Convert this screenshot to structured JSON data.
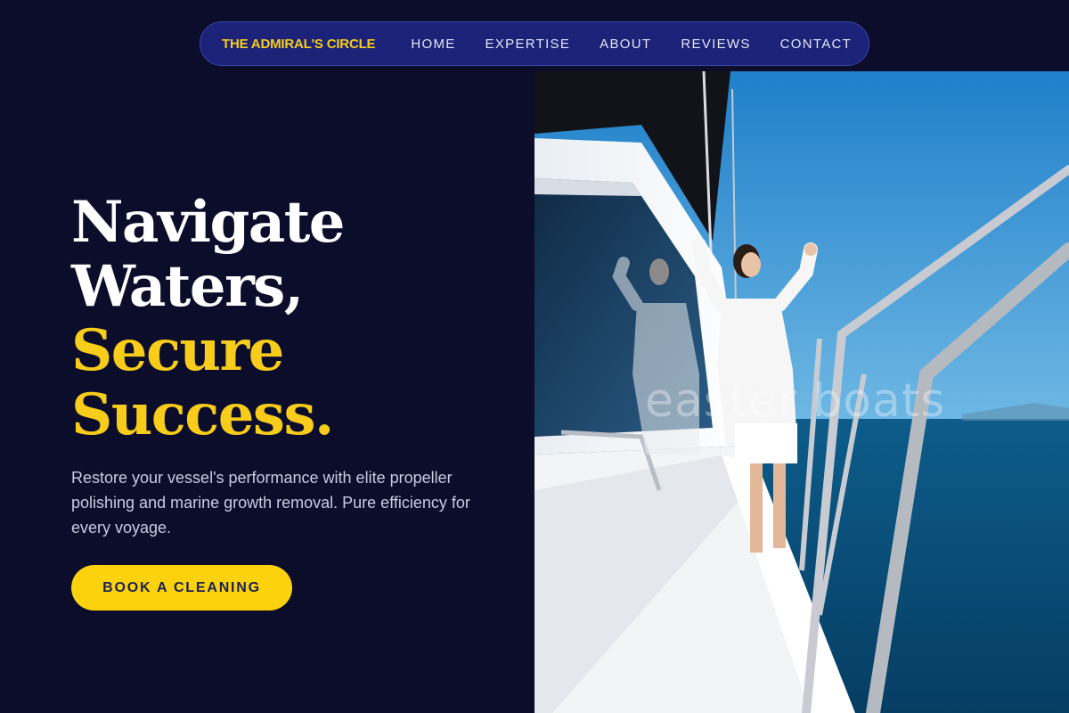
{
  "nav": {
    "brand": "THE ADMIRAL'S CIRCLE",
    "links": [
      "HOME",
      "EXPERTISE",
      "ABOUT",
      "REVIEWS",
      "CONTACT"
    ]
  },
  "hero": {
    "headline_white": [
      "Navigate",
      "Waters,"
    ],
    "headline_yellow": [
      "Secure",
      "Success."
    ],
    "lead": "Restore your vessel's performance with elite propeller polishing and marine growth removal. Pure efficiency for every voyage.",
    "cta_label": "BOOK A CLEANING",
    "image_watermark": "easter boats"
  },
  "colors": {
    "background": "#0b0d2a",
    "nav_background": "#1b2278",
    "accent": "#f7cc1a",
    "cta": "#fcd20d"
  }
}
